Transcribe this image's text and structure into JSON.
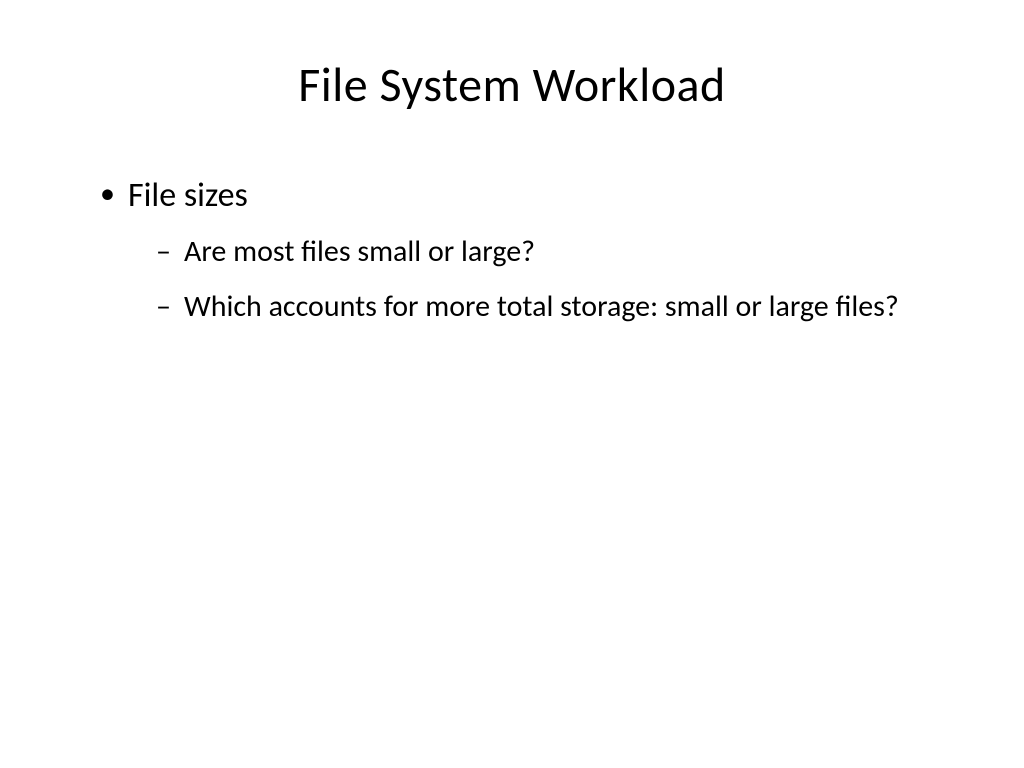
{
  "slide": {
    "title": "File System Workload",
    "bullets": [
      {
        "text": "File sizes",
        "children": [
          {
            "text": "Are most files small or large?"
          },
          {
            "text": "Which accounts for more total storage: small or large files?"
          }
        ]
      }
    ]
  }
}
